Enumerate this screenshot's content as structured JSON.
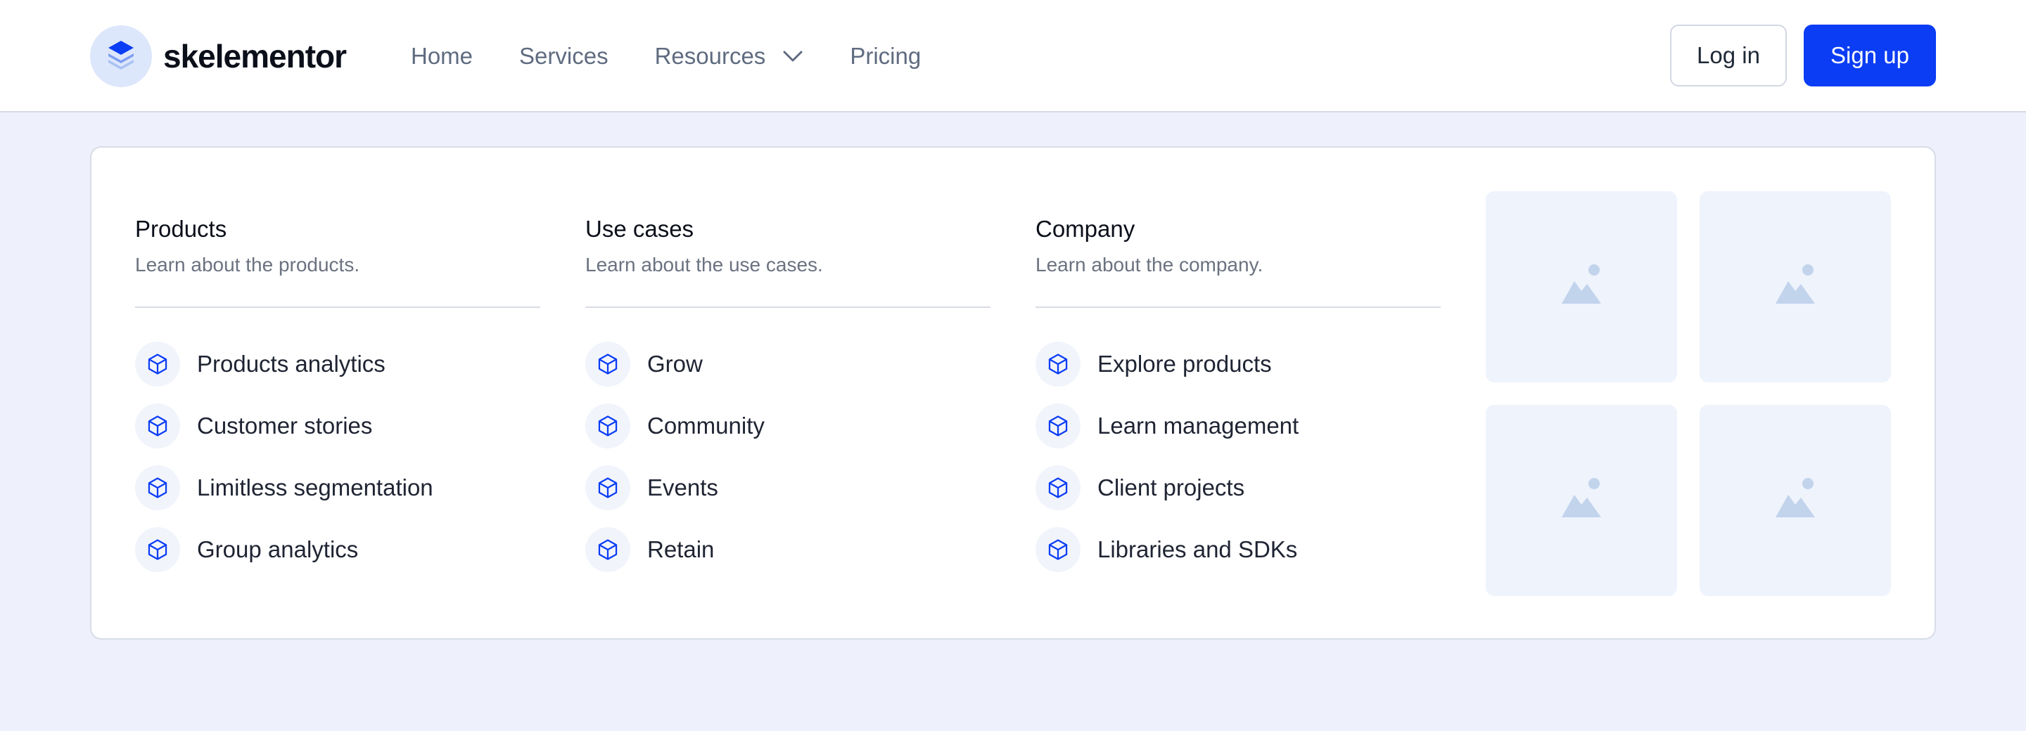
{
  "brand": {
    "name": "skelementor"
  },
  "nav": {
    "home": "Home",
    "services": "Services",
    "resources": "Resources",
    "pricing": "Pricing"
  },
  "auth": {
    "login": "Log in",
    "signup": "Sign up"
  },
  "menu": {
    "columns": [
      {
        "title": "Products",
        "description": "Learn about the products.",
        "items": [
          "Products analytics",
          "Customer stories",
          "Limitless segmentation",
          "Group analytics"
        ]
      },
      {
        "title": "Use cases",
        "description": "Learn about the use cases.",
        "items": [
          "Grow",
          "Community",
          "Events",
          "Retain"
        ]
      },
      {
        "title": "Company",
        "description": "Learn about the company.",
        "items": [
          "Explore products",
          "Learn management",
          "Client projects",
          "Libraries and SDKs"
        ]
      }
    ],
    "item_icon": "cube-icon",
    "image_placeholder_icon": "image-placeholder-icon"
  },
  "colors": {
    "accent": "#0b3df5",
    "page_background": "#eef1fc",
    "placeholder_tile": "#eef3fc",
    "placeholder_glyph": "#c2d3ec"
  }
}
